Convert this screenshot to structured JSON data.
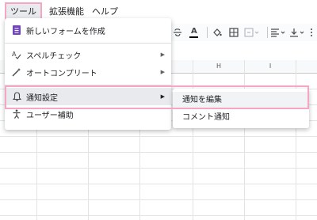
{
  "menubar": {
    "tools": "ツール",
    "extensions": "拡張機能",
    "help": "ヘルプ"
  },
  "toolbar": {
    "strike_icon": "strikethrough-icon",
    "text_color_glyph": "A",
    "text_color_bar": "#000000"
  },
  "sheet": {
    "columns": [
      "H",
      "I"
    ]
  },
  "tools_menu": {
    "items": [
      {
        "label": "新しいフォームを作成",
        "icon": "form-icon",
        "has_submenu": false
      },
      {
        "label": "スペルチェック",
        "icon": "spellcheck-icon",
        "has_submenu": true
      },
      {
        "label": "オートコンプリート",
        "icon": "autocomplete-icon",
        "has_submenu": true
      },
      {
        "label": "通知設定",
        "icon": "bell-icon",
        "has_submenu": true
      },
      {
        "label": "ユーザー補助",
        "icon": "accessibility-icon",
        "has_submenu": true
      }
    ]
  },
  "submenu": {
    "items": [
      "通知を編集",
      "コメント通知"
    ]
  },
  "colors": {
    "highlight_border": "#f4a6c4",
    "form_icon": "#7248b9",
    "menu_hover": "#e8eaed"
  }
}
